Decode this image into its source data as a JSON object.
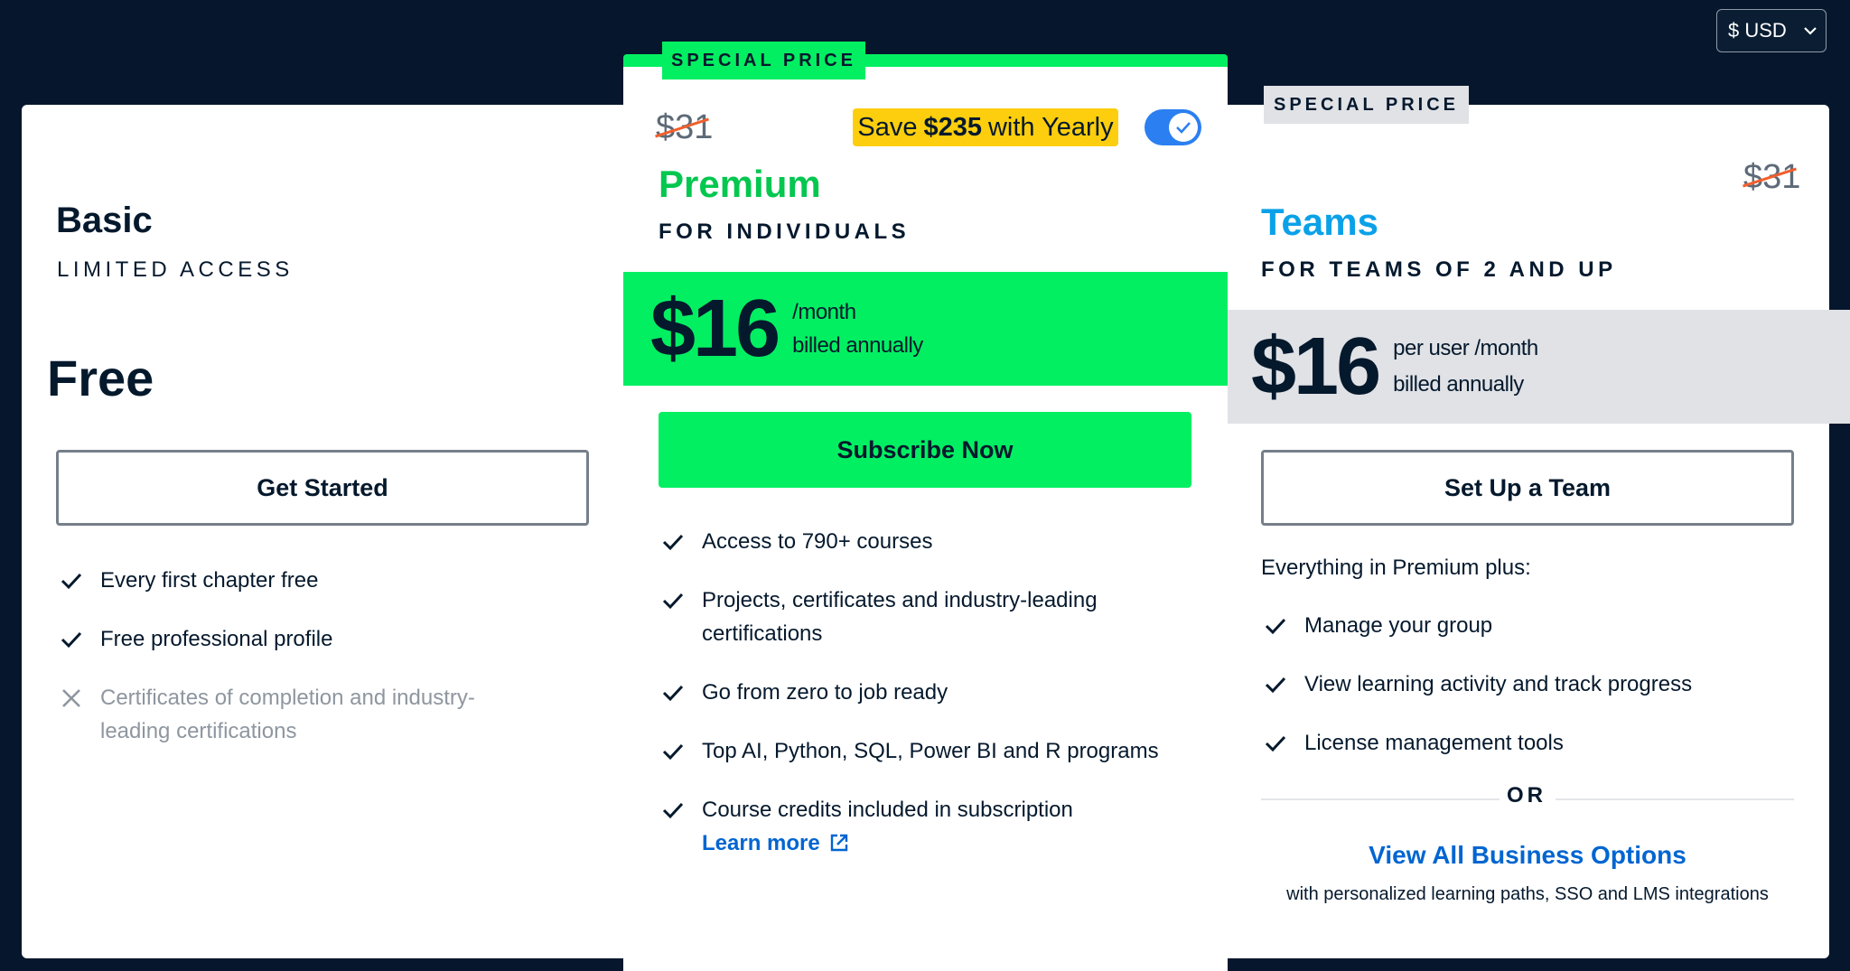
{
  "currency": {
    "label": "$ USD"
  },
  "basic": {
    "name": "Basic",
    "subtitle": "LIMITED ACCESS",
    "price": "Free",
    "button": "Get Started",
    "features": [
      {
        "text": "Every first chapter free",
        "included": true
      },
      {
        "text": "Free professional profile",
        "included": true
      },
      {
        "text": "Certificates of completion and industry-leading certifications",
        "included": false
      }
    ]
  },
  "premium": {
    "badge": "SPECIAL PRICE",
    "old_price": "$31",
    "save": {
      "prefix": "Save",
      "amount": "$235",
      "suffix": "with Yearly"
    },
    "toggle_on": true,
    "name": "Premium",
    "subtitle": "FOR INDIVIDUALS",
    "price": "$16",
    "per": "/month",
    "billing": "billed annually",
    "button": "Subscribe Now",
    "features": [
      "Access to 790+ courses",
      "Projects, certificates and industry-leading certifications",
      "Go from zero to job ready",
      "Top AI, Python, SQL, Power BI and R programs",
      "Course credits included in subscription"
    ],
    "learn_more": "Learn more"
  },
  "teams": {
    "badge": "SPECIAL PRICE",
    "old_price": "$31",
    "name": "Teams",
    "subtitle": "FOR TEAMS OF 2 AND UP",
    "price": "$16",
    "per": "per user /month",
    "billing": "billed annually",
    "button": "Set Up a Team",
    "intro": "Everything in Premium plus:",
    "features": [
      "Manage your group",
      "View learning activity and track progress",
      "License management tools"
    ],
    "or": "OR",
    "business_link": "View All Business Options",
    "business_note": "with personalized learning paths, SSO and LMS integrations"
  },
  "colors": {
    "background": "#06172d",
    "green": "#03ef62",
    "navy": "#05192d",
    "teams_blue": "#0aa1e8",
    "link_blue": "#0065d1",
    "save_yellow": "#fcce0d",
    "toggle_blue": "#2b7ff0",
    "strike_orange": "#f25f2c"
  }
}
